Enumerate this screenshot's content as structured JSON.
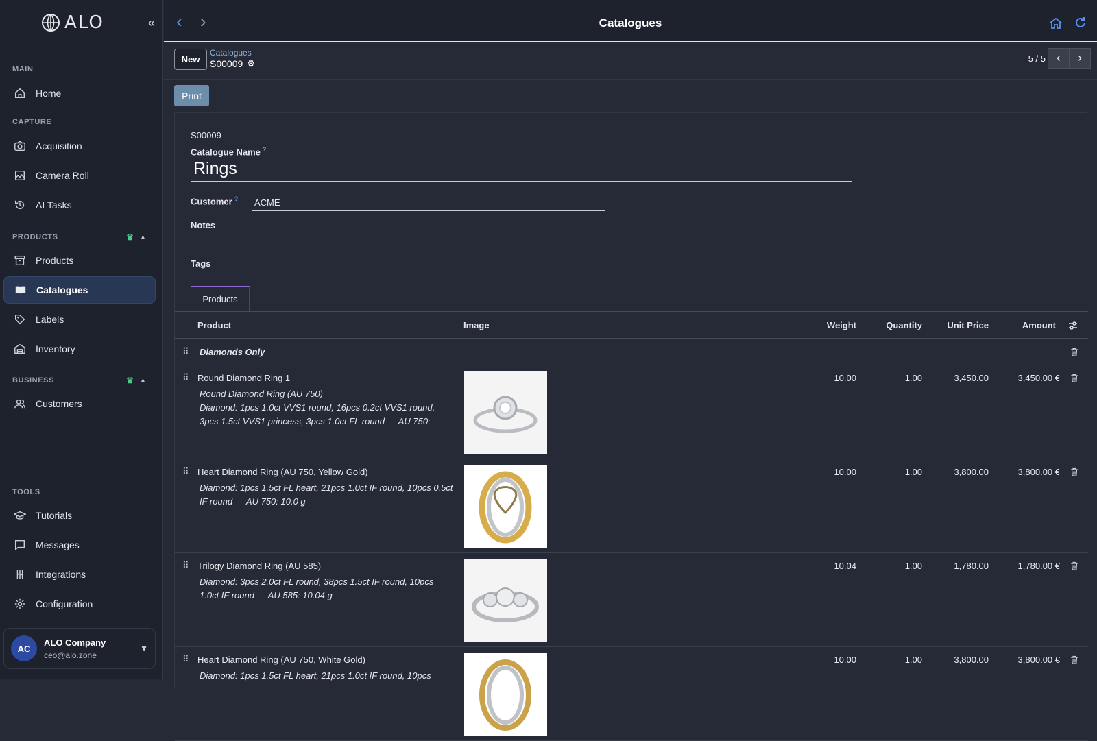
{
  "brand": {
    "name": "ALO"
  },
  "sidebar": {
    "sections": {
      "main": "MAIN",
      "capture": "CAPTURE",
      "products": "PRODUCTS",
      "business": "BUSINESS",
      "tools": "TOOLS"
    },
    "items": {
      "home": "Home",
      "acquisition": "Acquisition",
      "camera_roll": "Camera Roll",
      "ai_tasks": "AI Tasks",
      "products": "Products",
      "catalogues": "Catalogues",
      "labels": "Labels",
      "inventory": "Inventory",
      "customers": "Customers",
      "tutorials": "Tutorials",
      "messages": "Messages",
      "integrations": "Integrations",
      "configuration": "Configuration"
    },
    "active": "catalogues",
    "user": {
      "initials": "AC",
      "name": "ALO Company",
      "email": "ceo@alo.zone"
    }
  },
  "topbar": {
    "title": "Catalogues"
  },
  "control": {
    "new_label": "New",
    "breadcrumb": "Catalogues",
    "record": "S00009",
    "pager": "5 / 5"
  },
  "actions": {
    "print_label": "Print"
  },
  "form": {
    "reference": "S00009",
    "name_label": "Catalogue Name",
    "help_mark": "?",
    "name_value": "Rings",
    "customer_label": "Customer",
    "customer_value": "ACME",
    "notes_label": "Notes",
    "tags_label": "Tags",
    "tab_products": "Products"
  },
  "table": {
    "headers": {
      "product": "Product",
      "image": "Image",
      "weight": "Weight",
      "quantity": "Quantity",
      "unit_price": "Unit Price",
      "amount": "Amount"
    },
    "section": "Diamonds Only",
    "rows": [
      {
        "name": "Round Diamond Ring 1",
        "desc": "Round Diamond Ring (AU 750)\nDiamond: 1pcs 1.0ct VVS1 round, 16pcs 0.2ct VVS1 round, 3pcs 1.5ct VVS1 princess, 3pcs 1.0ct FL round — AU 750:",
        "weight": "10.00",
        "quantity": "1.00",
        "unit_price": "3,450.00",
        "amount": "3,450.00 €",
        "image": "round-halo-ring"
      },
      {
        "name": "Heart Diamond Ring (AU 750, Yellow Gold)",
        "desc": "Diamond: 1pcs 1.5ct FL heart, 21pcs 1.0ct IF round, 10pcs 0.5ct IF round — AU 750: 10.0 g",
        "weight": "10.00",
        "quantity": "1.00",
        "unit_price": "3,800.00",
        "amount": "3,800.00 €",
        "image": "heart-ring-yellow-gold"
      },
      {
        "name": "Trilogy Diamond Ring (AU 585)",
        "desc": "Diamond: 3pcs 2.0ct FL round, 38pcs 1.5ct IF round, 10pcs 1.0ct IF round — AU 585: 10.04 g",
        "weight": "10.04",
        "quantity": "1.00",
        "unit_price": "1,780.00",
        "amount": "1,780.00 €",
        "image": "trilogy-ring"
      },
      {
        "name": "Heart Diamond Ring (AU 750, White Gold)",
        "desc": "Diamond: 1pcs 1.5ct FL heart, 21pcs 1.0ct IF round, 10pcs",
        "weight": "10.00",
        "quantity": "1.00",
        "unit_price": "3,800.00",
        "amount": "3,800.00 €",
        "image": "heart-ring-white-gold"
      }
    ]
  }
}
